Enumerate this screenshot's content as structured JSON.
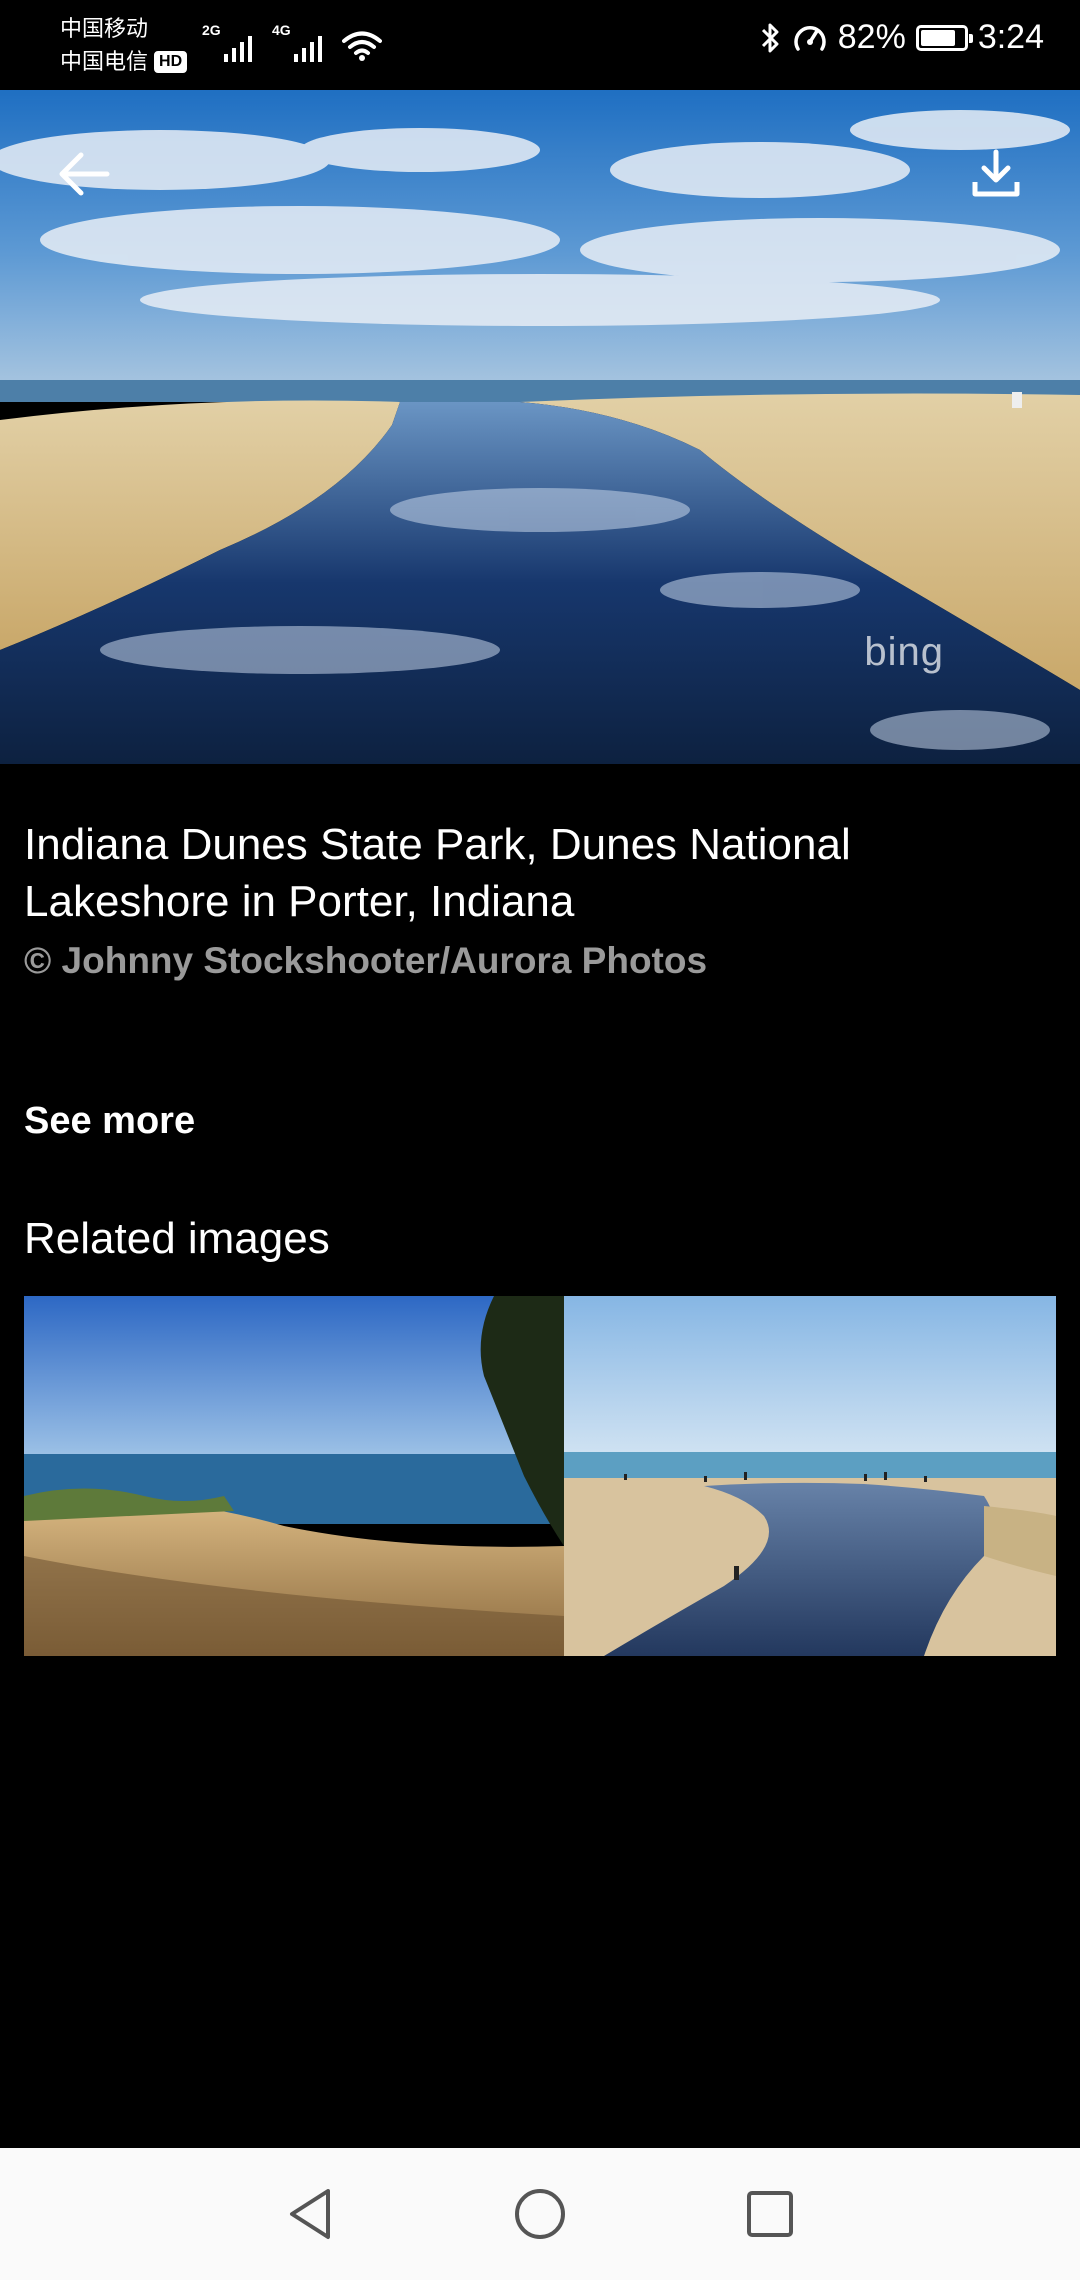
{
  "status_bar": {
    "carrier_1": "中国移动",
    "carrier_2": "中国电信",
    "hd_badge": "HD",
    "signal_1_gen": "2G",
    "signal_2_gen": "4G",
    "battery_text": "82%",
    "battery_level": 0.82,
    "time": "3:24",
    "icons": [
      "signal-icon",
      "wifi-icon",
      "bluetooth-icon",
      "speed-icon",
      "battery-icon"
    ]
  },
  "hero": {
    "watermark": "bing",
    "back_icon": "arrow-left-icon",
    "download_icon": "download-icon"
  },
  "caption": {
    "title": "Indiana Dunes State Park, Dunes National Lakeshore in Porter, Indiana",
    "copyright": "© Johnny Stockshooter/Aurora Photos"
  },
  "see_more_label": "See more",
  "related": {
    "heading": "Related images"
  },
  "nav_bar": {
    "icons": [
      "back-triangle-icon",
      "home-circle-icon",
      "recents-square-icon"
    ]
  },
  "colors": {
    "background": "#000000",
    "secondary_text": "#9a9a9a",
    "nav_bar_bg": "#fafafa"
  }
}
